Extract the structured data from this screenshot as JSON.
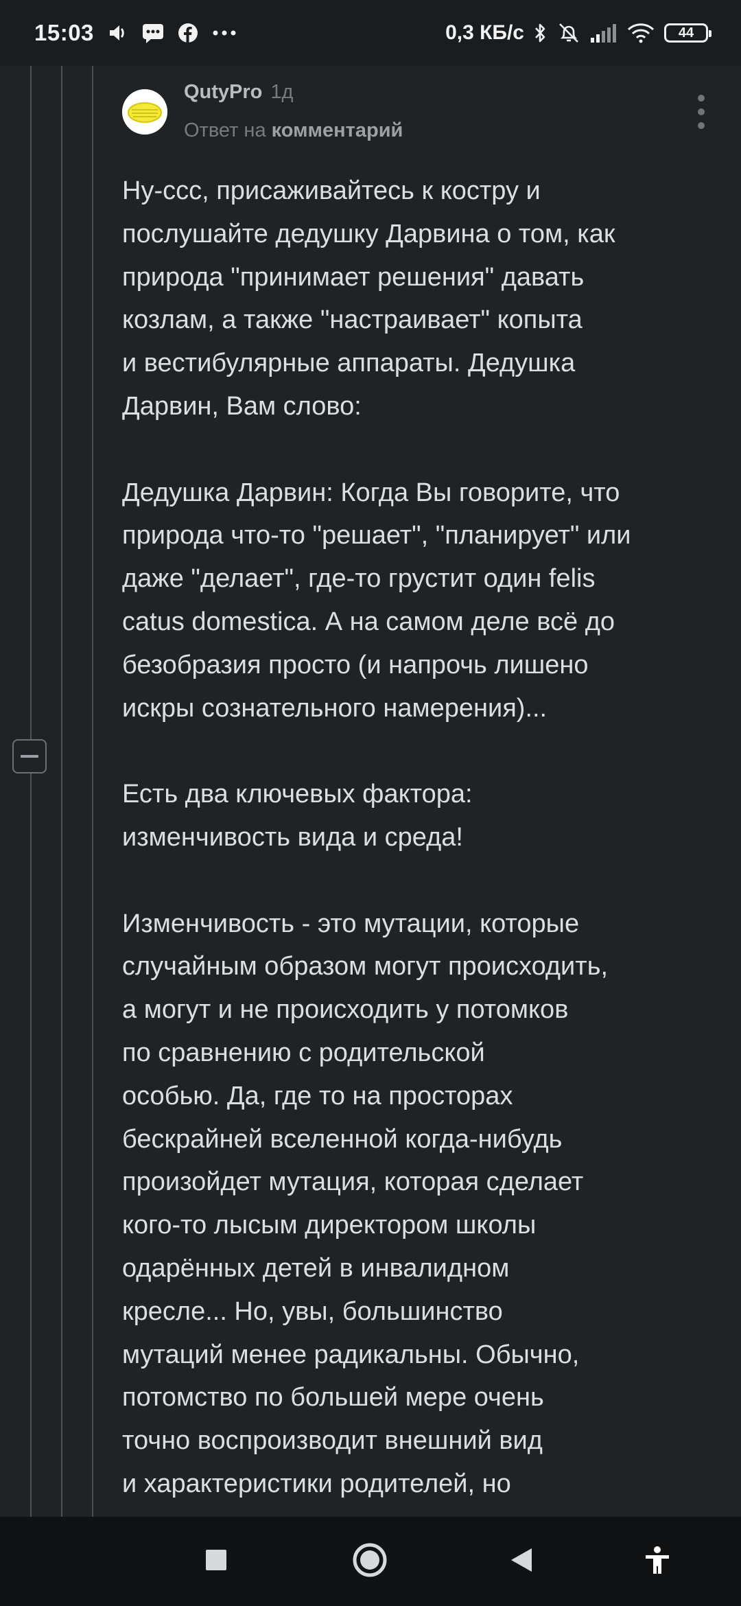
{
  "status_bar": {
    "time": "15:03",
    "network_speed": "0,3 КБ/с",
    "battery_level": "44",
    "left_icons": [
      "volume-icon",
      "message-icon",
      "facebook-icon",
      "more-notifications-icon"
    ],
    "right_icons": [
      "bluetooth-icon",
      "alarm-off-icon",
      "signal-icon",
      "wifi-icon",
      "battery-icon"
    ]
  },
  "comment": {
    "author": "QutyPro",
    "time_ago": "1д",
    "reply_prefix": "Ответ на",
    "reply_target": "комментарий",
    "paragraphs": [
      [
        "Ну-ссс, присаживайтесь к костру и",
        "послушайте дедушку Дарвина о том, как",
        "природа \"принимает решения\" давать",
        "козлам, а также \"настраивает\" копыта",
        "и вестибулярные аппараты. Дедушка",
        "Дарвин, Вам слово:"
      ],
      [
        "Дедушка Дарвин: Когда Вы говорите, что",
        "природа что-то \"решает\", \"планирует\" или",
        "даже \"делает\", где-то грустит один felis",
        "catus domestica. А на самом деле всё до",
        "безобразия просто (и напрочь лишено",
        "искры сознательного намерения)..."
      ],
      [
        "Есть два ключевых фактора:",
        "изменчивость вида и среда!"
      ],
      [
        "Изменчивость - это мутации, которые",
        "случайным образом могут происходить,",
        "а могут и не происходить у потомков",
        "по сравнению с родительской",
        "особью. Да, где то на просторах",
        "бескрайней вселенной когда-нибудь",
        "произойдет мутация, которая сделает",
        "кого-то лысым директором школы",
        "одарённых детей в инвалидном",
        "кресле... Но, увы, большинство",
        "мутаций менее радикальны. Обычно,",
        "потомство по большей мере очень",
        "точно воспроизводит внешний вид",
        "и характеристики родителей, но"
      ]
    ]
  },
  "navigation": {
    "buttons": [
      "recents-square-icon",
      "home-circle-icon",
      "back-triangle-icon",
      "accessibility-icon"
    ]
  },
  "colors": {
    "background": "#1f2326",
    "status_bar": "#1a1d1f",
    "nav_bar": "#101214",
    "body_text": "#dcdee0",
    "muted_text": "#767b80",
    "thread_line": "#4a4f53"
  }
}
